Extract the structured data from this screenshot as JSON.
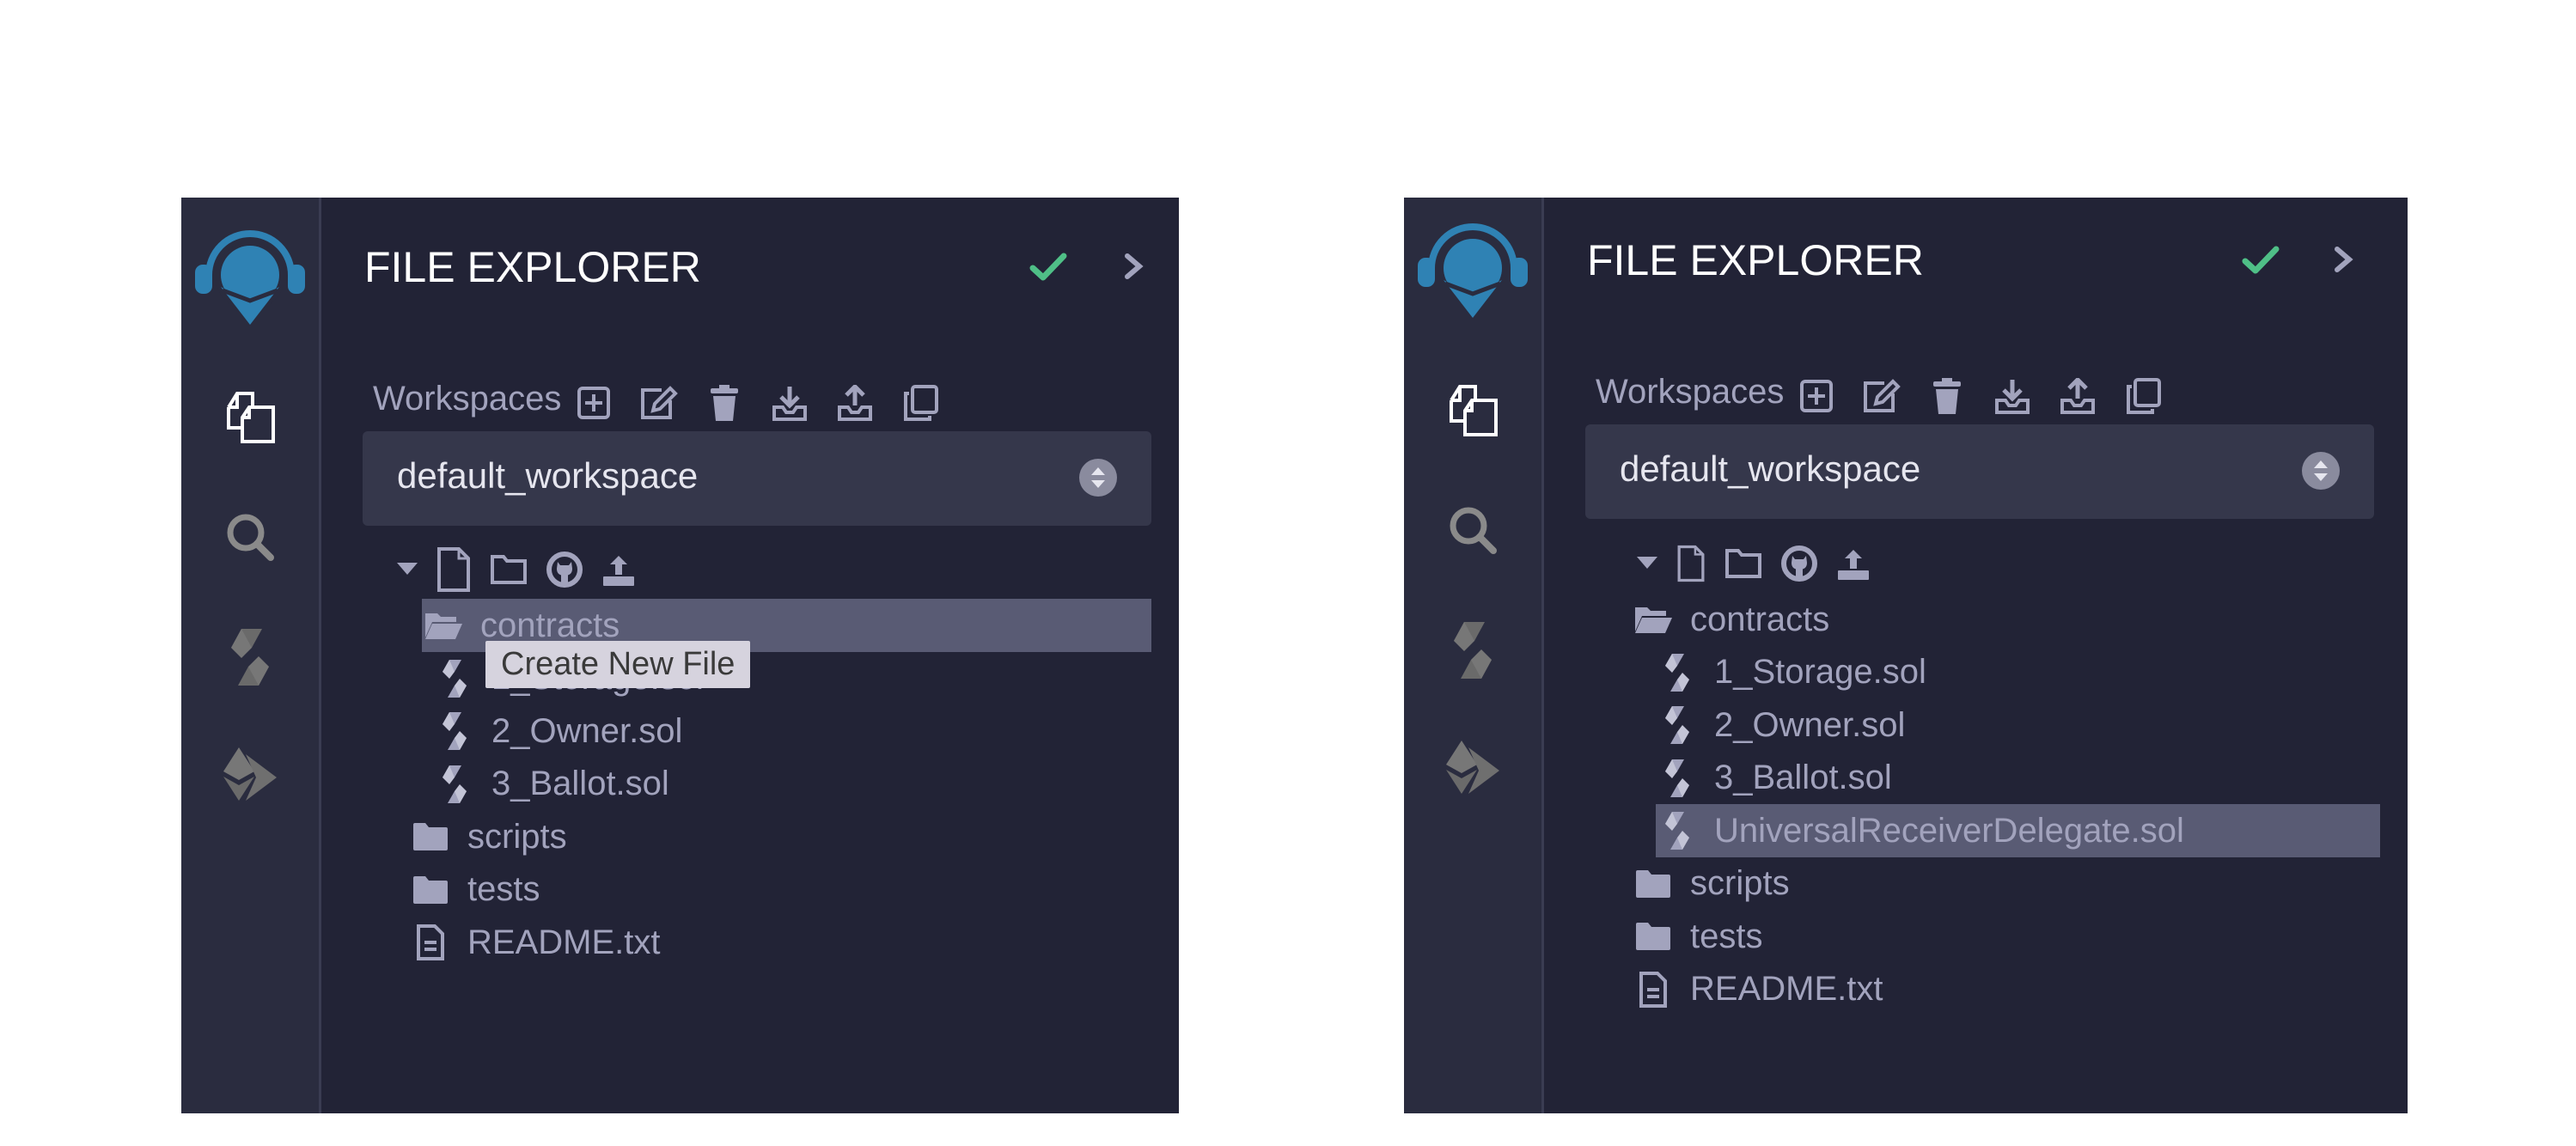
{
  "panels": [
    {
      "id": "left",
      "header": {
        "title": "FILE EXPLORER",
        "status_icon": "check-icon",
        "collapse_icon": "chevron-right-icon"
      },
      "sidebar": {
        "icons": [
          "file-explorer-icon",
          "search-icon",
          "solidity-compiler-icon",
          "deploy-run-icon"
        ],
        "active": "file-explorer-icon"
      },
      "workspaces": {
        "label": "Workspaces",
        "actions": [
          "create-workspace-icon",
          "rename-workspace-icon",
          "delete-workspace-icon",
          "download-workspace-icon",
          "restore-workspace-icon",
          "clone-workspace-icon"
        ],
        "selected": "default_workspace"
      },
      "tree_toolbar": [
        "collapse-caret-icon",
        "new-file-icon",
        "new-folder-icon",
        "github-icon",
        "upload-icon"
      ],
      "tree": [
        {
          "type": "folder-open",
          "label": "contracts",
          "depth": 0,
          "selected": true
        },
        {
          "type": "sol",
          "label": "1_Storage.sol",
          "depth": 1,
          "selected": false
        },
        {
          "type": "sol",
          "label": "2_Owner.sol",
          "depth": 1,
          "selected": false
        },
        {
          "type": "sol",
          "label": "3_Ballot.sol",
          "depth": 1,
          "selected": false
        },
        {
          "type": "folder",
          "label": "scripts",
          "depth": 0,
          "selected": false
        },
        {
          "type": "folder",
          "label": "tests",
          "depth": 0,
          "selected": false
        },
        {
          "type": "file",
          "label": "README.txt",
          "depth": 0,
          "selected": false
        }
      ],
      "tooltip": "Create New File"
    },
    {
      "id": "right",
      "header": {
        "title": "FILE EXPLORER",
        "status_icon": "check-icon",
        "collapse_icon": "chevron-right-icon"
      },
      "sidebar": {
        "icons": [
          "file-explorer-icon",
          "search-icon",
          "solidity-compiler-icon",
          "deploy-run-icon"
        ],
        "active": "file-explorer-icon"
      },
      "workspaces": {
        "label": "Workspaces",
        "actions": [
          "create-workspace-icon",
          "rename-workspace-icon",
          "delete-workspace-icon",
          "download-workspace-icon",
          "restore-workspace-icon",
          "clone-workspace-icon"
        ],
        "selected": "default_workspace"
      },
      "tree_toolbar": [
        "collapse-caret-icon",
        "new-file-icon",
        "new-folder-icon",
        "github-icon",
        "upload-icon"
      ],
      "tree": [
        {
          "type": "folder-open",
          "label": "contracts",
          "depth": 0,
          "selected": false
        },
        {
          "type": "sol",
          "label": "1_Storage.sol",
          "depth": 1,
          "selected": false
        },
        {
          "type": "sol",
          "label": "2_Owner.sol",
          "depth": 1,
          "selected": false
        },
        {
          "type": "sol",
          "label": "3_Ballot.sol",
          "depth": 1,
          "selected": false
        },
        {
          "type": "sol",
          "label": "UniversalReceiverDelegate.sol",
          "depth": 1,
          "selected": true
        },
        {
          "type": "folder",
          "label": "scripts",
          "depth": 0,
          "selected": false
        },
        {
          "type": "folder",
          "label": "tests",
          "depth": 0,
          "selected": false
        },
        {
          "type": "file",
          "label": "README.txt",
          "depth": 0,
          "selected": false
        }
      ]
    }
  ],
  "colors": {
    "accent_check": "#4fbf87",
    "logo": "#2f82b4",
    "panel_bg": "#222336",
    "iconbar_bg": "#2a2c3f",
    "selected_row": "#595b74",
    "text_muted": "#a2a3bd"
  }
}
